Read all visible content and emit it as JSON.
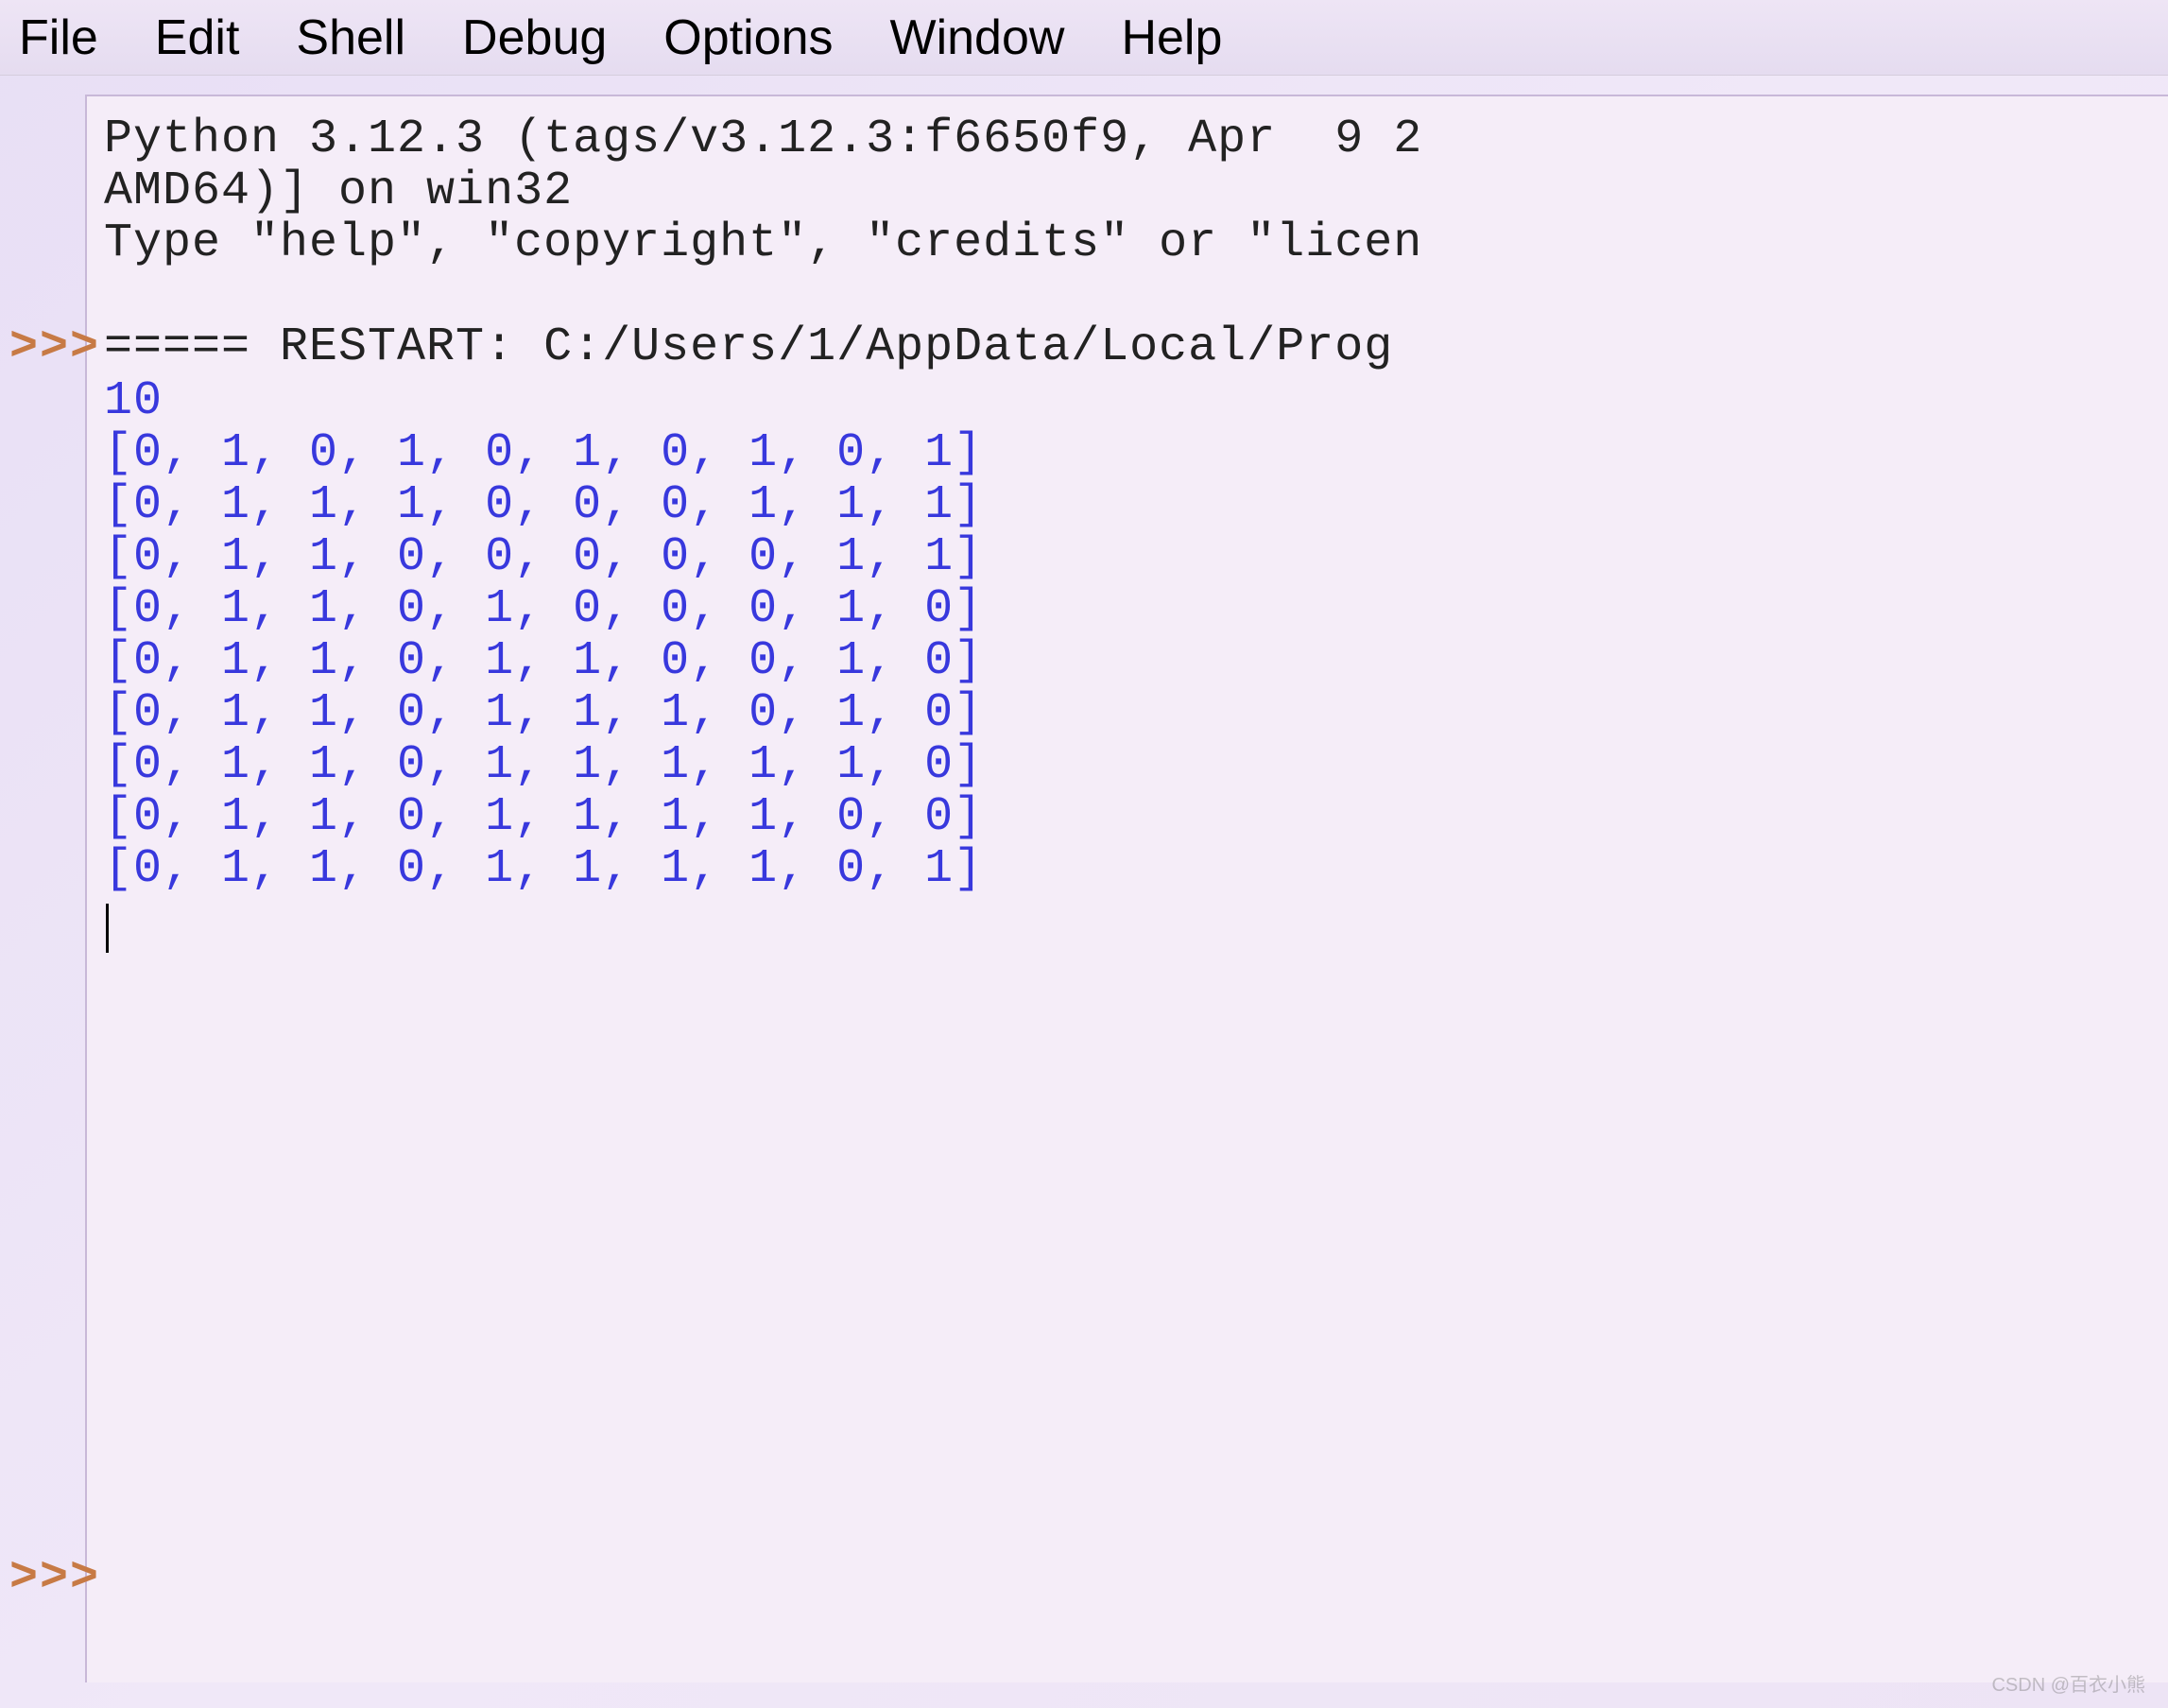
{
  "menu": {
    "file": "File",
    "edit": "Edit",
    "shell": "Shell",
    "debug": "Debug",
    "options": "Options",
    "window": "Window",
    "help": "Help"
  },
  "prompt": ">>>",
  "shell": {
    "version_line1": "Python 3.12.3 (tags/v3.12.3:f6650f9, Apr  9 2",
    "version_line2": "AMD64)] on win32",
    "help_line": "Type \"help\", \"copyright\", \"credits\" or \"licen",
    "restart_line": "===== RESTART: C:/Users/1/AppData/Local/Prog",
    "output_lines": [
      "10",
      "[0, 1, 0, 1, 0, 1, 0, 1, 0, 1]",
      "[0, 1, 1, 1, 0, 0, 0, 1, 1, 1]",
      "[0, 1, 1, 0, 0, 0, 0, 0, 1, 1]",
      "[0, 1, 1, 0, 1, 0, 0, 0, 1, 0]",
      "[0, 1, 1, 0, 1, 1, 0, 0, 1, 0]",
      "[0, 1, 1, 0, 1, 1, 1, 0, 1, 0]",
      "[0, 1, 1, 0, 1, 1, 1, 1, 1, 0]",
      "[0, 1, 1, 0, 1, 1, 1, 1, 0, 0]",
      "[0, 1, 1, 0, 1, 1, 1, 1, 0, 1]"
    ]
  },
  "watermark": "CSDN @百衣小熊"
}
